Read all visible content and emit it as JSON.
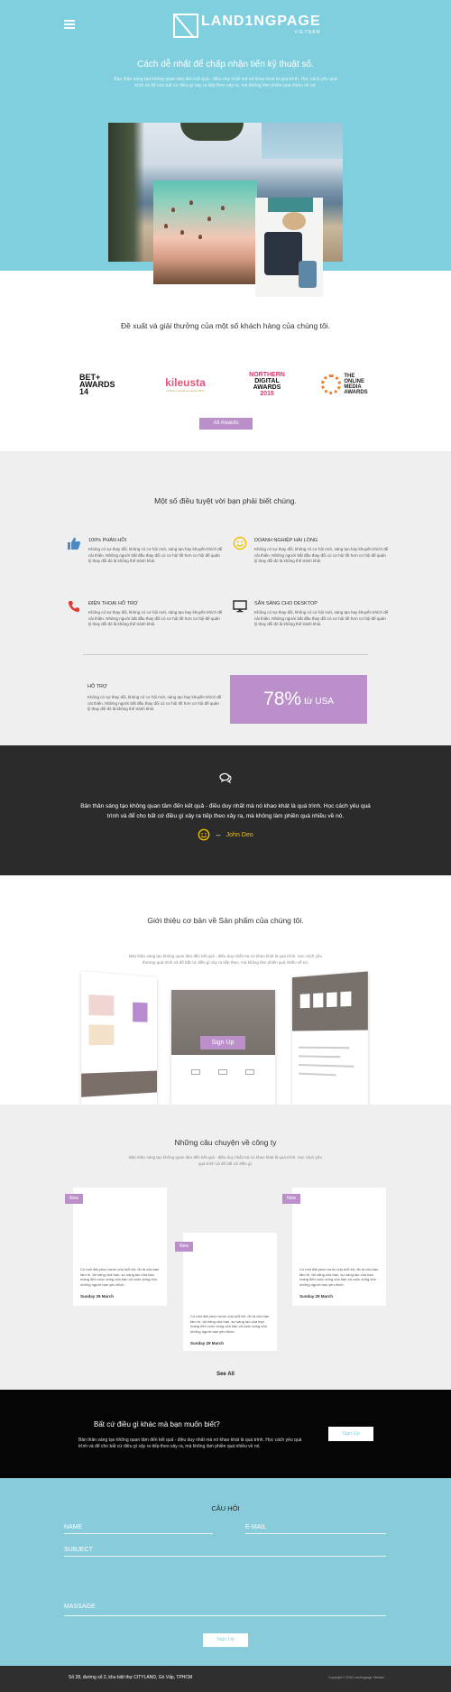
{
  "header": {
    "logo_main": "LAND1NGPAGE",
    "logo_sub": "VIETNAM",
    "title": "Cách dễ nhất để chấp nhận tiến kỹ thuật số.",
    "subtitle": "Bản thân sáng tạo không quan tâm đến kết quả - điều duy nhất mà nó khao khát là quá trình. Học cách yêu quá trình và để cho bất cứ điều gì xảy ra tiếp theo xảy ra, mà không làm phiền quá nhiều về nó."
  },
  "awards": {
    "title": "Đề xuất và giải thưởng của một số khách hàng của chúng tôi.",
    "logos": {
      "bet_line1": "BET+",
      "bet_line2": "AWARDS 14",
      "kile": "kileusta",
      "kile_small": "creative excellence award 2015",
      "northern_1": "NORTHERN",
      "northern_2": "DIGITAL",
      "northern_3": "AWARDS",
      "northern_4": "2015",
      "online_1": "THE",
      "online_2": "ONLINE",
      "online_3": "MEDIA",
      "online_4": "AWARDS"
    },
    "button": "All Awards"
  },
  "features": {
    "title": "Một số điều tuyệt vời bạn phải biết chúng.",
    "items": [
      {
        "icon": "thumbs-up-icon",
        "title": "100% PHẢN HỒI",
        "text": "Không có sự thay đổi, không có cơ hội mới, sáng tạo hay khuyến khích để cải thiện. Những người bất đầu thay đổi có cơ hội tốt hơn cơ hội để quản lý thay đổi đó là không thể tránh khỏi."
      },
      {
        "icon": "smiley-icon",
        "title": "DOANH NGHIỆP HÀI LÒNG",
        "text": "Không có sự thay đổi, không có cơ hội mới, sáng tạo hay khuyến khích để cải thiện. Những người bất đầu thay đổi có cơ hội tốt hơn cơ hội để quản lý thay đổi đó là không thể tránh khỏi."
      },
      {
        "icon": "phone-icon",
        "title": "ĐIỆN THOẠI HỖ TRỢ",
        "text": "Không có sự thay đổi, không có cơ hội mới, sáng tạo hay khuyến khích để cải thiện. Những người bất đầu thay đổi có cơ hội tốt hơn cơ hội để quản lý thay đổi đó là không thể tránh khỏi."
      },
      {
        "icon": "monitor-icon",
        "title": "SẴN SÀNG CHO DESKTOP",
        "text": "Không có sự thay đổi, không có cơ hội mới, sáng tạo hay khuyến khích để cải thiện. Những người bất đầu thay đổi có cơ hội tốt hơn cơ hội để quản lý thay đổi đó là không thể tránh khỏi."
      }
    ],
    "support_title": "HỖ TRỢ",
    "support_text": "Không có sự thay đổi, không có cơ hội mới, sáng tạo hay khuyến khích để cải thiện. Những người bất đầu thay đổi có cơ hội tốt hơn cơ hội để quản lý thay đổi đó là không thể tránh khỏi.",
    "stat_value": "78%",
    "stat_unit": "từ USA"
  },
  "testimonial": {
    "text": "Bản thân sáng tạo không quan tâm đến kết quả - điều duy nhất mà nó khao khát là quá trình. Học cách yêu quá trình và để cho bất cứ điều gì xảy ra tiếp theo xảy ra, mà không làm phiền quá nhiều về nó.",
    "dash": "--",
    "author": "John Deo"
  },
  "products": {
    "title": "Giới thiệu cơ bản về Sản phẩm của chúng tôi.",
    "subtitle": "Bản thân sáng tạo không quan tâm đến kết quả - điều duy nhất mà nó khao khát là quá trình. Học cách yêu thương quá trình và để bất cứ điều gì xảy ra tiếp theo, mà không làm phiền quá nhiều về nó.",
    "signup_label": "Sign Up"
  },
  "stories": {
    "title": "Những câu chuyện về công ty",
    "subtitle": "Bản thân sáng tạo không quan tâm đến kết quả - điều duy nhất mà nó khao khát là quá trình. Học cách yêu quá trình và để bất cứ điều gì.",
    "badge": "New",
    "cards": [
      {
        "text": "Có một đất phun nước của tuổi trẻ; đó là của bạn tâm trí, tài năng của bạn, sự sáng tạo của bạn mang đến cuộc sống của bạn và cuộc sống của những người bạn yêu thích.",
        "date": "Sunday 29 March"
      },
      {
        "text": "Có một đất phun nước của tuổi trẻ; đó là của bạn tâm trí, tài năng của bạn, sự sáng tạo của bạn mang đến cuộc sống của bạn và cuộc sống của những người bạn yêu thích.",
        "date": "Sunday 29 March"
      },
      {
        "text": "Có một đất phun nước của tuổi trẻ; đó là của bạn tâm trí, tài năng của bạn, sự sáng tạo của bạn mang đến cuộc sống của bạn và cuộc sống của những người bạn yêu thích.",
        "date": "Sunday 29 March"
      }
    ],
    "see_all": "See All"
  },
  "cta": {
    "title": "Bất cứ điều gì khác mà bạn muốn biết?",
    "text": "Bản thân sáng tạo không quan tâm đến kết quả - điều duy nhất mà nó khao khát là quá trình. Học cách yêu quá trình và để cho bất cứ điều gì xảy ra tiếp theo xảy ra, mà không làm phiền quá nhiều về nó.",
    "button": "Sign Up"
  },
  "contact": {
    "title": "CÂU HỎI",
    "name_placeholder": "NAME",
    "email_placeholder": "E-MAIL",
    "subject_placeholder": "SUBJECT",
    "message_placeholder": "MASSAGE",
    "button": "Sign Up"
  },
  "footer": {
    "address": "Số 28, đường số 2, khu biệt thự CITYLAND, Gò Vấp, TPHCM",
    "copyright": "Copyright © 2016 Landingpage Vietnam"
  },
  "colors": {
    "hero": "#7fcfde",
    "accent": "#bb8fc9",
    "dark": "#2b2b2b",
    "gold": "#f2c200"
  }
}
